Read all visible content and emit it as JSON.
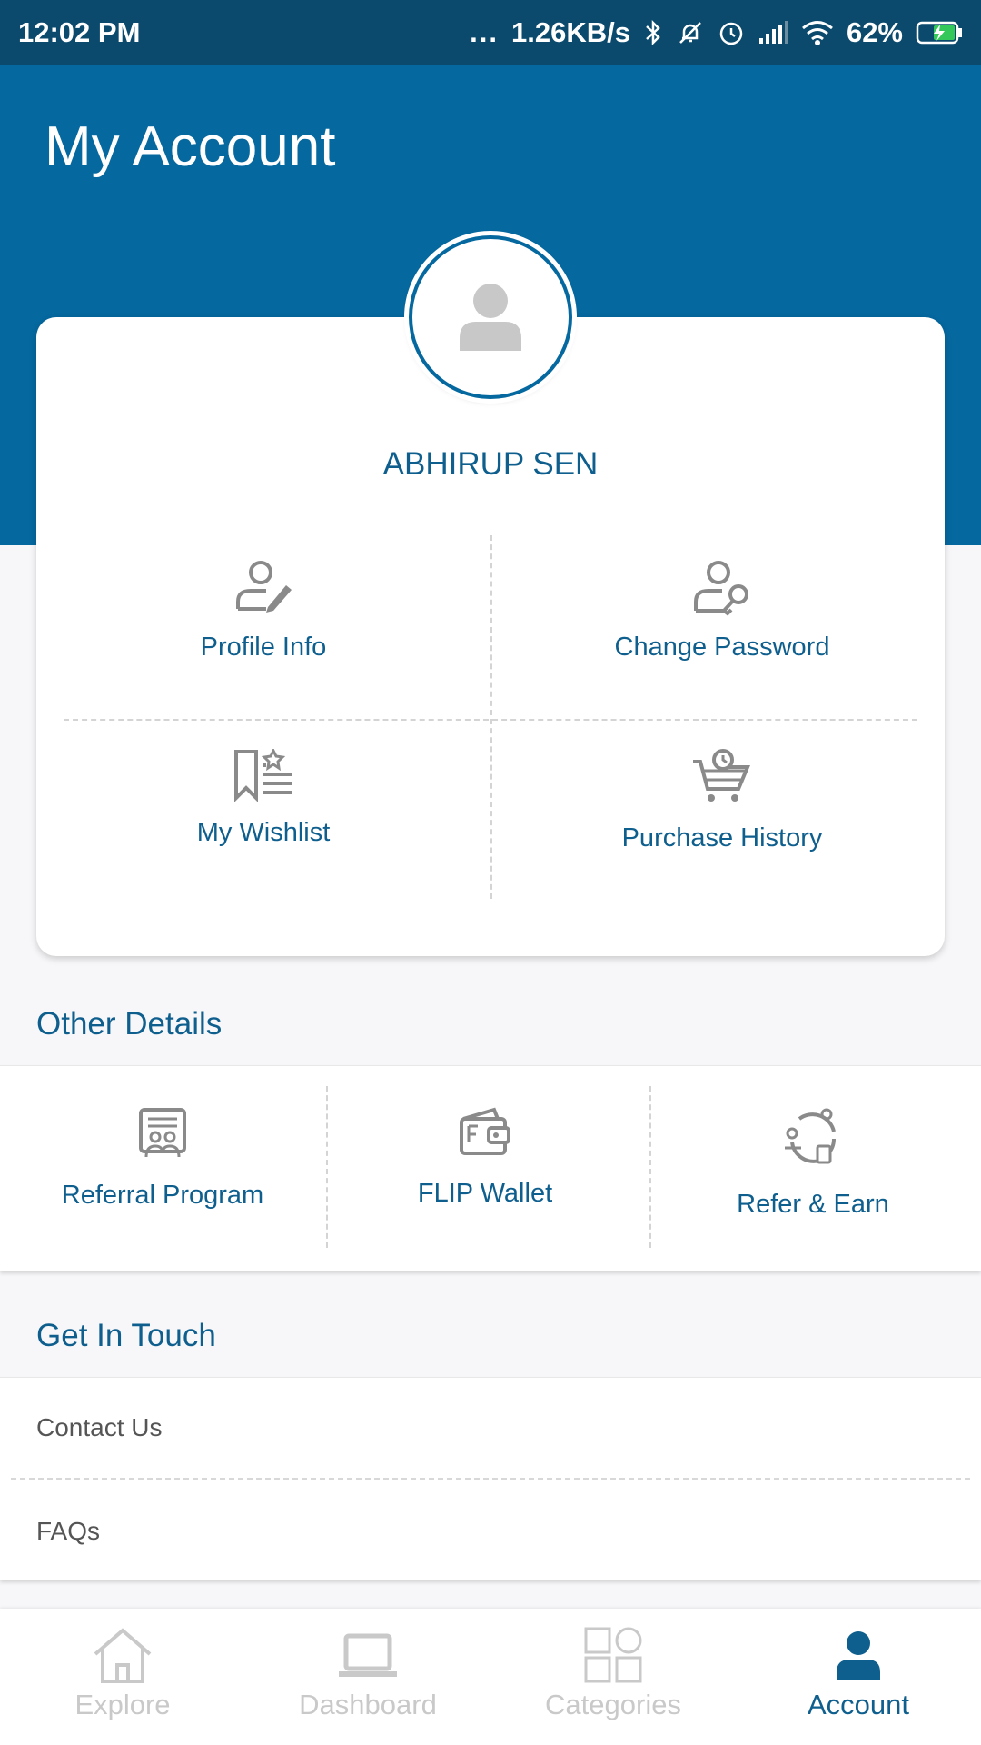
{
  "status_bar": {
    "time": "12:02 PM",
    "more_dots": "...",
    "network_speed": "1.26KB/s",
    "battery": "62%"
  },
  "header": {
    "title": "My Account"
  },
  "profile": {
    "name": "ABHIRUP SEN",
    "items": [
      {
        "label": "Profile Info",
        "icon": "user-edit-icon"
      },
      {
        "label": "Change Password",
        "icon": "user-key-icon"
      },
      {
        "label": "My Wishlist",
        "icon": "wishlist-icon"
      },
      {
        "label": "Purchase History",
        "icon": "cart-history-icon"
      }
    ]
  },
  "other_details": {
    "title": "Other Details",
    "items": [
      {
        "label": "Referral Program",
        "icon": "referral-icon"
      },
      {
        "label": "FLIP Wallet",
        "icon": "wallet-icon"
      },
      {
        "label": "Refer & Earn",
        "icon": "refer-earn-icon"
      }
    ]
  },
  "get_in_touch": {
    "title": "Get In Touch",
    "items": [
      "Contact Us",
      "FAQs"
    ]
  },
  "bottom_nav": {
    "tabs": [
      {
        "label": "Explore",
        "icon": "home-icon",
        "active": false
      },
      {
        "label": "Dashboard",
        "icon": "laptop-icon",
        "active": false
      },
      {
        "label": "Categories",
        "icon": "grid-icon",
        "active": false
      },
      {
        "label": "Account",
        "icon": "account-icon",
        "active": true
      }
    ]
  },
  "colors": {
    "header": "#05689f",
    "status_bar": "#0b4a6d",
    "accent_text": "#0f5f8e",
    "inactive_nav": "#c9c9c9"
  }
}
